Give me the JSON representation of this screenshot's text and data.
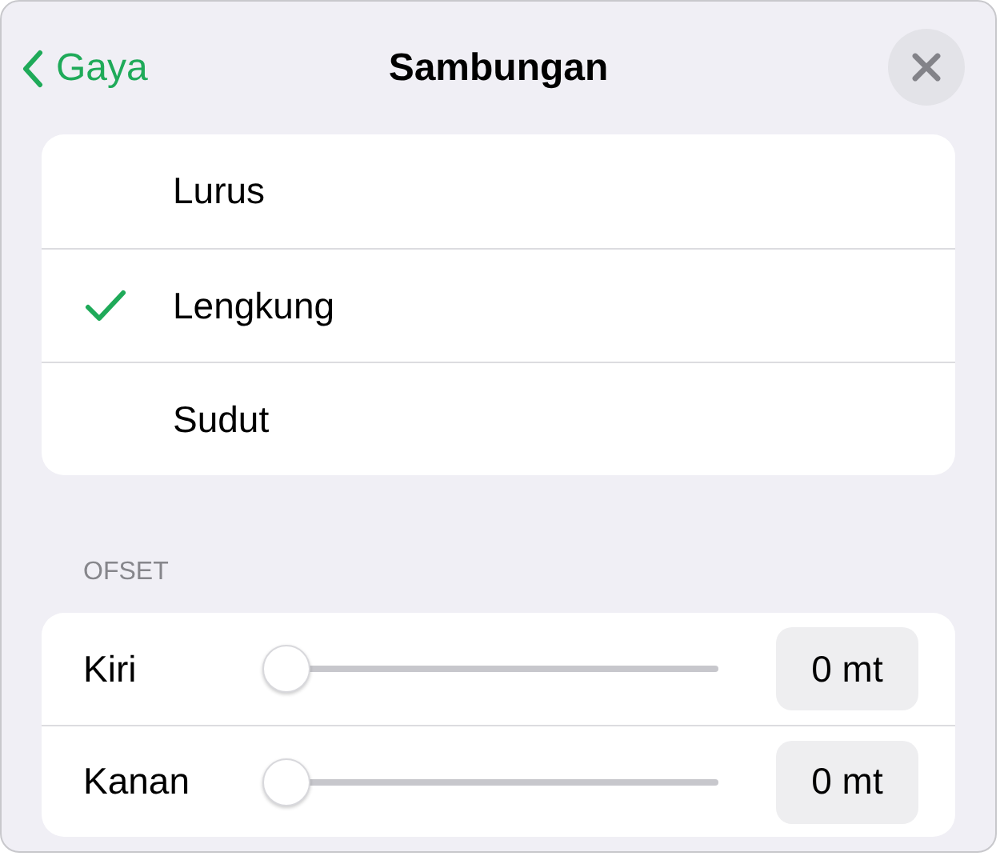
{
  "header": {
    "back": "Gaya",
    "title": "Sambungan"
  },
  "options": [
    {
      "label": "Lurus",
      "selected": false
    },
    {
      "label": "Lengkung",
      "selected": true
    },
    {
      "label": "Sudut",
      "selected": false
    }
  ],
  "offset": {
    "heading": "OFSET",
    "sliders": [
      {
        "label": "Kiri",
        "level": 0,
        "value": "0 mt"
      },
      {
        "label": "Kanan",
        "level": 0,
        "value": "0 mt"
      }
    ]
  }
}
